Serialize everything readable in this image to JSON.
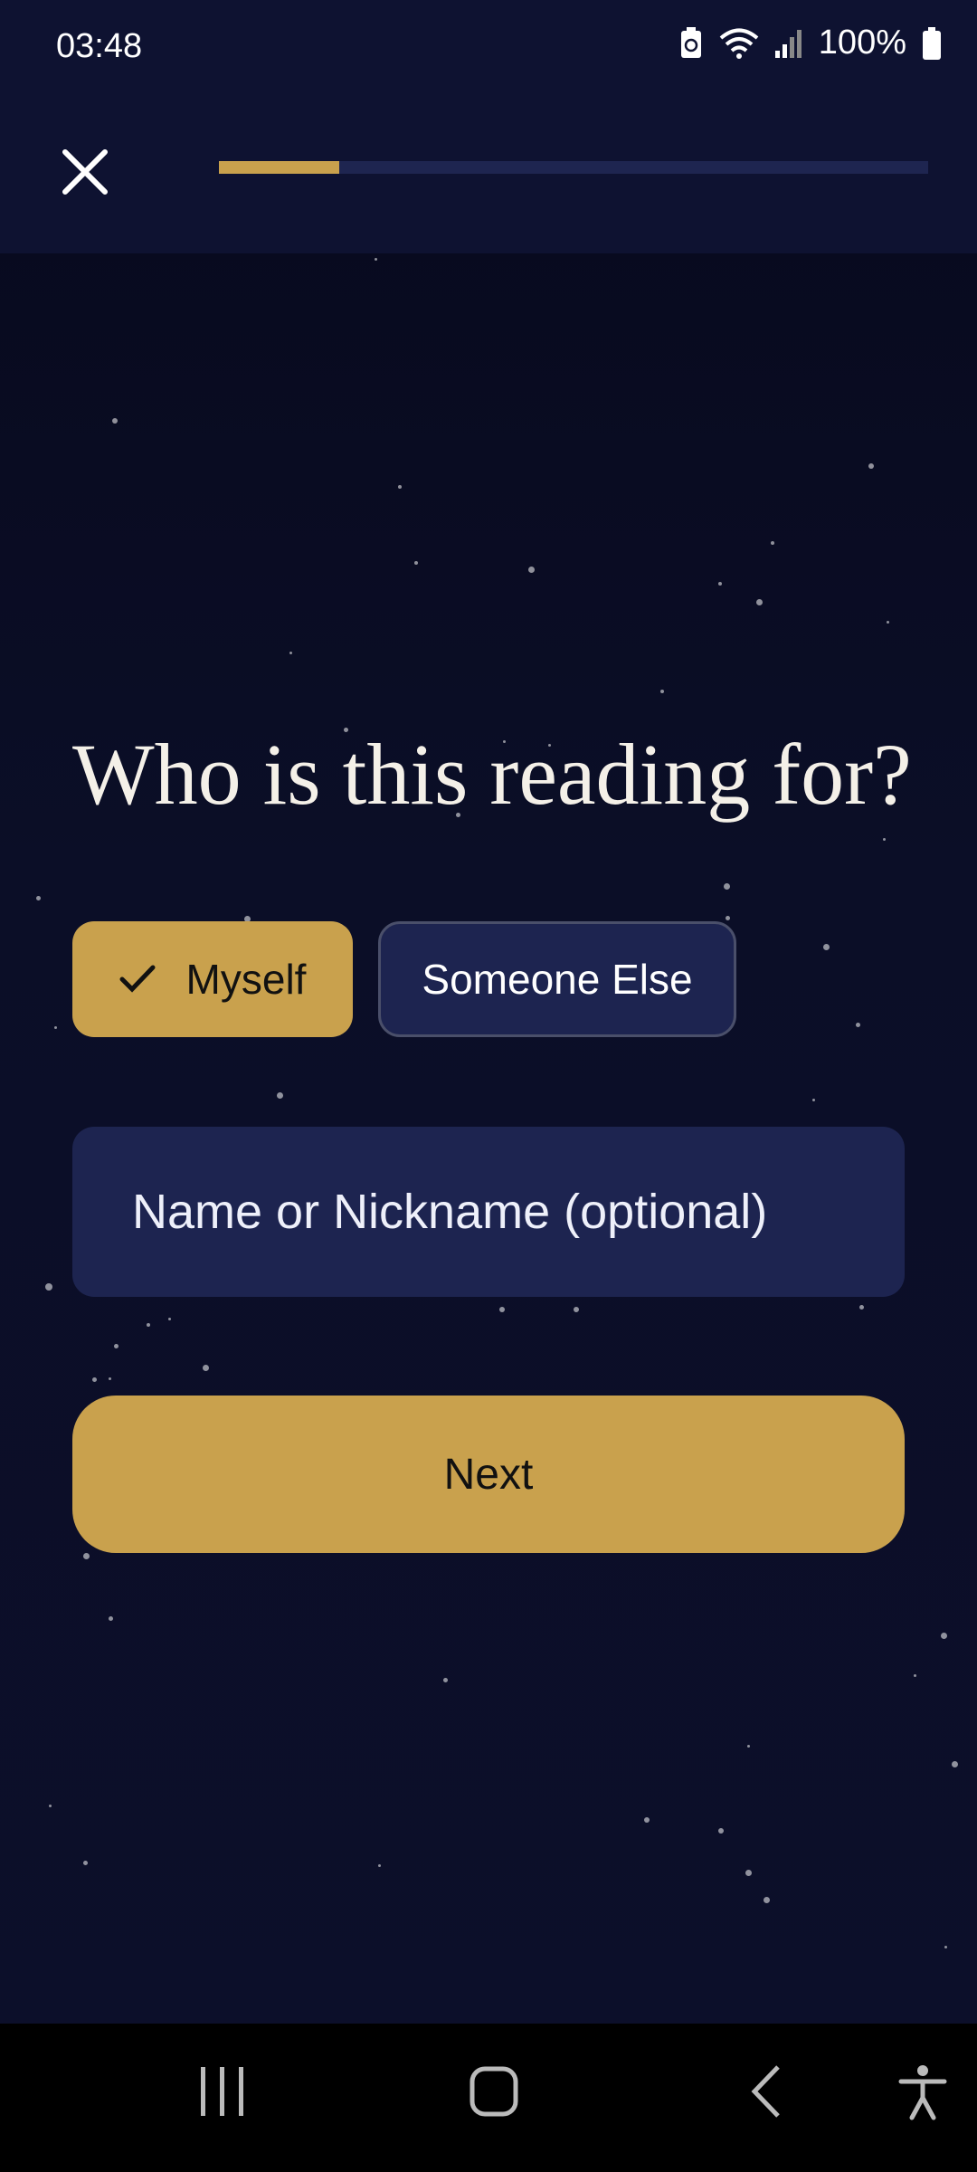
{
  "status": {
    "time": "03:48",
    "battery": "100%",
    "icons": [
      "battery-saver-icon",
      "wifi-icon",
      "signal-icon",
      "battery-icon"
    ]
  },
  "header": {
    "close_icon": "close-icon",
    "progress_fraction": 0.17
  },
  "question": "Who is this reading for?",
  "options": [
    {
      "label": "Myself",
      "selected": true,
      "icon": "check-icon"
    },
    {
      "label": "Someone Else",
      "selected": false
    }
  ],
  "name_field": {
    "placeholder": "Name or Nickname (optional)",
    "value": ""
  },
  "next_label": "Next",
  "nav": [
    "recent-apps-icon",
    "home-icon",
    "back-icon",
    "accessibility-icon"
  ],
  "colors": {
    "accent": "#c9a14d",
    "background": "#0b0e27",
    "surface": "#1d2450"
  }
}
